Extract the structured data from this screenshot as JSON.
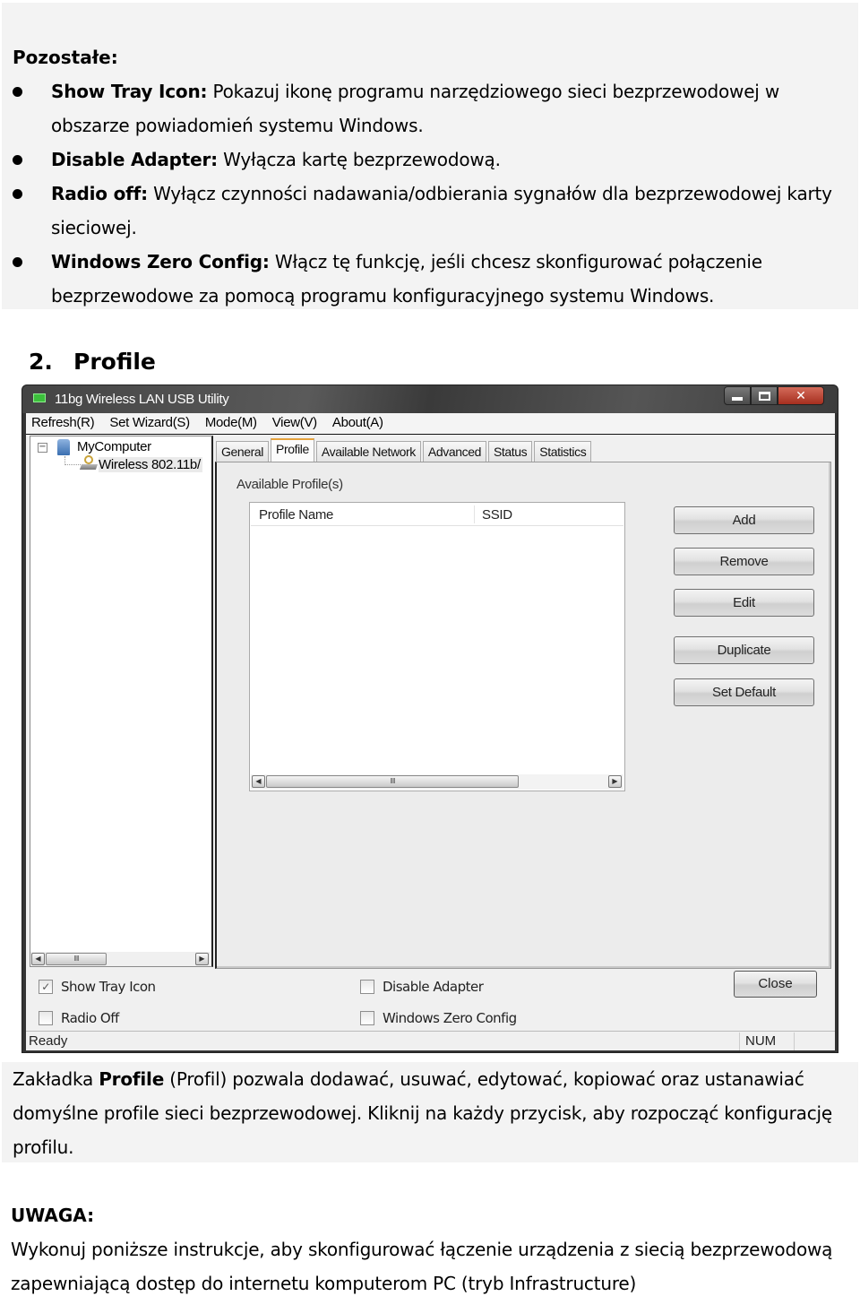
{
  "top_section": {
    "heading": "Pozostałe:",
    "bullets": [
      {
        "term": "Show Tray Icon:",
        "text": " Pokazuj ikonę programu narzędziowego sieci bezprzewodowej w obszarze powiadomień systemu Windows."
      },
      {
        "term": "Disable Adapter:",
        "text": " Wyłącza kartę bezprzewodową."
      },
      {
        "term": "Radio off:",
        "text": " Wyłącz czynności nadawania/odbierania sygnałów dla bezprzewodowej karty sieciowej."
      },
      {
        "term": "Windows Zero Config:",
        "text": " Włącz tę funkcję, jeśli chcesz skonfigurować połączenie bezprzewodowe za pomocą programu konfiguracyjnego systemu Windows."
      }
    ]
  },
  "section_title": {
    "number": "2.",
    "label": "Profile"
  },
  "window": {
    "title": "11bg Wireless LAN USB Utility",
    "menu": [
      "Refresh(R)",
      "Set Wizard(S)",
      "Mode(M)",
      "View(V)",
      "About(A)"
    ],
    "tree": {
      "root": "MyComputer",
      "child": "Wireless 802.11b/"
    },
    "tabs": [
      "General",
      "Profile",
      "Available Network",
      "Advanced",
      "Status",
      "Statistics"
    ],
    "active_tab": "Profile",
    "panel": {
      "label": "Available Profile(s)",
      "columns": [
        "Profile Name",
        "SSID"
      ],
      "rows": [],
      "buttons": [
        "Add",
        "Remove",
        "Edit",
        "Duplicate",
        "Set Default"
      ]
    },
    "options": [
      {
        "label": "Show Tray Icon",
        "checked": true
      },
      {
        "label": "Radio Off",
        "checked": false
      },
      {
        "label": "Disable Adapter",
        "checked": false
      },
      {
        "label": "Windows Zero Config",
        "checked": false
      }
    ],
    "close_label": "Close",
    "status": {
      "text": "Ready",
      "num": "NUM"
    },
    "scroll_thumb_glyph": "IIII",
    "check_glyph": "✓"
  },
  "mid_section": {
    "prefix": "Zakładka ",
    "bold": "Profile",
    "text": " (Profil) pozwala dodawać, usuwać, edytować, kopiować oraz ustanawiać domyślne profile sieci bezprzewodowej. Kliknij na każdy przycisk, aby rozpocząć konfigurację profilu."
  },
  "note": {
    "heading": "UWAGA:",
    "text": "Wykonuj poniższe instrukcje, aby skonfigurować łączenie urządzenia z siecią bezprzewodową zapewniającą dostęp do internetu komputerom PC (tryb Infrastructure)"
  }
}
